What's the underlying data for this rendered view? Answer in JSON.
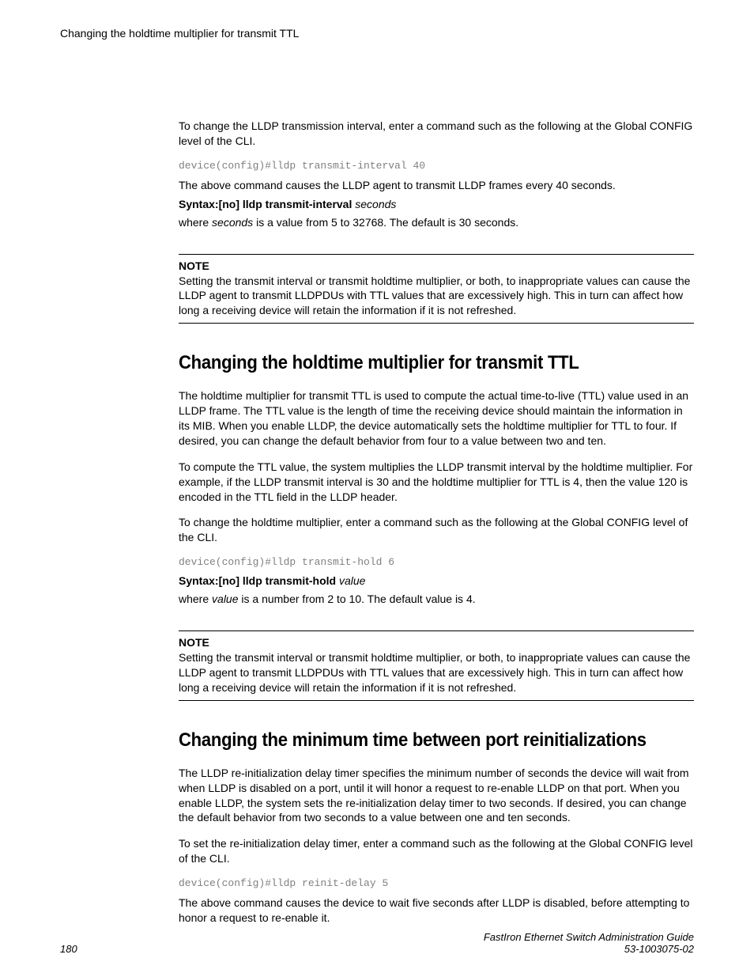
{
  "header": {
    "running_title": "Changing the holdtime multiplier for transmit TTL"
  },
  "section1": {
    "intro": "To change the LLDP transmission interval, enter a command such as the following at the Global CONFIG level of the CLI.",
    "code": "device(config)#lldp transmit-interval 40",
    "result": "The above command causes the LLDP agent to transmit LLDP frames every 40 seconds.",
    "syntax_bold": "Syntax:[no] lldp transmit-interval ",
    "syntax_italic": "seconds",
    "where_pre": "where ",
    "where_italic": "seconds",
    "where_post": " is a value from 5 to 32768. The default is 30 seconds.",
    "note_label": "NOTE",
    "note_body": "Setting the transmit interval or transmit holdtime multiplier, or both, to inappropriate values can cause the LLDP agent to transmit LLDPDUs with TTL values that are excessively high. This in turn can affect how long a receiving device will retain the information if it is not refreshed."
  },
  "section2": {
    "heading": "Changing the holdtime multiplier for transmit TTL",
    "p1": "The holdtime multiplier for transmit TTL is used to compute the actual time-to-live (TTL) value used in an LLDP frame. The TTL value is the length of time the receiving device should maintain the information in its MIB. When you enable LLDP, the device automatically sets the holdtime multiplier for TTL to four. If desired, you can change the default behavior from four to a value between two and ten.",
    "p2": "To compute the TTL value, the system multiplies the LLDP transmit interval by the holdtime multiplier. For example, if the LLDP transmit interval is 30 and the holdtime multiplier for TTL is 4, then the value 120 is encoded in the TTL field in the LLDP header.",
    "p3": "To change the holdtime multiplier, enter a command such as the following at the Global CONFIG level of the CLI.",
    "code": "device(config)#lldp transmit-hold 6",
    "syntax_bold": "Syntax:[no] lldp transmit-hold ",
    "syntax_italic": "value",
    "where_pre": "where ",
    "where_italic": "value",
    "where_post": " is a number from 2 to 10. The default value is 4.",
    "note_label": "NOTE",
    "note_body": "Setting the transmit interval or transmit holdtime multiplier, or both, to inappropriate values can cause the LLDP agent to transmit LLDPDUs with TTL values that are excessively high. This in turn can affect how long a receiving device will retain the information if it is not refreshed."
  },
  "section3": {
    "heading": "Changing the minimum time between port reinitializations",
    "p1": "The LLDP re-initialization delay timer specifies the minimum number of seconds the device will wait from when LLDP is disabled on a port, until it will honor a request to re-enable LLDP on that port. When you enable LLDP, the system sets the re-initialization delay timer to two seconds. If desired, you can change the default behavior from two seconds to a value between one and ten seconds.",
    "p2": "To set the re-initialization delay timer, enter a command such as the following at the Global CONFIG level of the CLI.",
    "code": "device(config)#lldp reinit-delay 5",
    "p3": "The above command causes the device to wait five seconds after LLDP is disabled, before attempting to honor a request to re-enable it."
  },
  "footer": {
    "page_number": "180",
    "guide_title": "FastIron Ethernet Switch Administration Guide",
    "doc_number": "53-1003075-02"
  }
}
